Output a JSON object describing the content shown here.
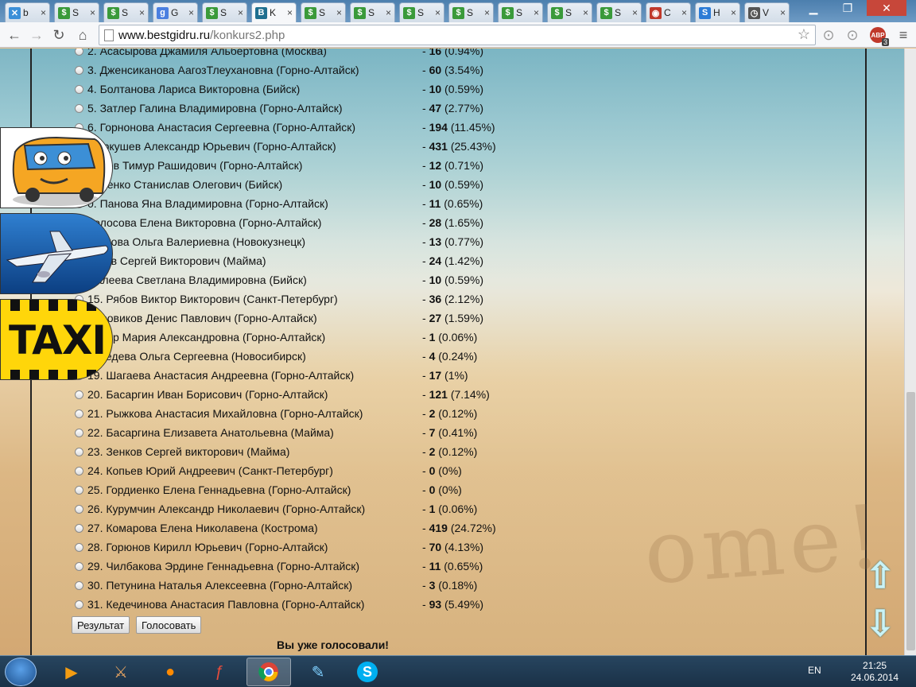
{
  "browser": {
    "tabs": [
      {
        "label": "b",
        "icon": "x-icon",
        "color": "#3b8fd8",
        "glyph": "✕"
      },
      {
        "label": "S",
        "icon": "dollar-icon",
        "color": "#3a9a3a",
        "glyph": "$"
      },
      {
        "label": "S",
        "icon": "dollar-icon",
        "color": "#3a9a3a",
        "glyph": "$"
      },
      {
        "label": "G",
        "icon": "google-icon",
        "color": "#4a7fe0",
        "glyph": "g"
      },
      {
        "label": "S",
        "icon": "dollar-icon",
        "color": "#3a9a3a",
        "glyph": "$"
      },
      {
        "label": "K",
        "icon": "bg-icon",
        "color": "#1f6f8f",
        "glyph": "B"
      },
      {
        "label": "S",
        "icon": "dollar-icon",
        "color": "#3a9a3a",
        "glyph": "$"
      },
      {
        "label": "S",
        "icon": "dollar-icon",
        "color": "#3a9a3a",
        "glyph": "$"
      },
      {
        "label": "S",
        "icon": "dollar-icon",
        "color": "#3a9a3a",
        "glyph": "$"
      },
      {
        "label": "S",
        "icon": "dollar-icon",
        "color": "#3a9a3a",
        "glyph": "$"
      },
      {
        "label": "S",
        "icon": "dollar-icon",
        "color": "#3a9a3a",
        "glyph": "$"
      },
      {
        "label": "S",
        "icon": "dollar-icon",
        "color": "#3a9a3a",
        "glyph": "$"
      },
      {
        "label": "S",
        "icon": "dollar-icon",
        "color": "#3a9a3a",
        "glyph": "$"
      },
      {
        "label": "C",
        "icon": "camera-icon",
        "color": "#c0392b",
        "glyph": "◉"
      },
      {
        "label": "H",
        "icon": "sb-icon",
        "color": "#2c7bd6",
        "glyph": "S"
      },
      {
        "label": "V",
        "icon": "clock-icon",
        "color": "#555555",
        "glyph": "◷"
      }
    ],
    "url_host": "www.bestgidru.ru",
    "url_path": "/konkurs2.php",
    "abp_badge": "3"
  },
  "poll": {
    "rows": [
      {
        "name": "2. Асасырова Джамиля Альбертовна (Москва)",
        "votes": "16",
        "pct": "(0.94%)"
      },
      {
        "name": "3. Дженсиканова АагозТлеухановна (Горно-Алтайск)",
        "votes": "60",
        "pct": "(3.54%)"
      },
      {
        "name": "4. Болтанова Лариса Викторовна (Бийск)",
        "votes": "10",
        "pct": "(0.59%)"
      },
      {
        "name": "5. Затлер Галина Владимировна (Горно-Алтайск)",
        "votes": "47",
        "pct": "(2.77%)"
      },
      {
        "name": "6. Горнонова Анастасия Сергеевна (Горно-Алтайск)",
        "votes": "194",
        "pct": "(11.45%)"
      },
      {
        "name": "Меркушев Александр Юрьевич (Горно-Алтайск)",
        "votes": "431",
        "pct": "(25.43%)"
      },
      {
        "name": "жанов Тимур Рашидович (Горно-Алтайск)",
        "votes": "12",
        "pct": "(0.71%)"
      },
      {
        "name": "емченко Станислав Олегович (Бийск)",
        "votes": "10",
        "pct": "(0.59%)"
      },
      {
        "name": "0. Панова Яна Владимировна (Горно-Алтайск)",
        "votes": "11",
        "pct": "(0.65%)"
      },
      {
        "name": "Колосова Елена Викторовна (Горно-Алтайск)",
        "votes": "28",
        "pct": "(1.65%)"
      },
      {
        "name": "ерикова Ольга Валериевна (Новокузнецк)",
        "votes": "13",
        "pct": "(0.77%)"
      },
      {
        "name": "енков Сергей Викторович (Майма)",
        "votes": "24",
        "pct": "(1.42%)"
      },
      {
        "name": "Фалеева Светлана Владимировна (Бийск)",
        "votes": "10",
        "pct": "(0.59%)"
      },
      {
        "name": "15. Рябов Виктор Викторович (Санкт-Петербург)",
        "votes": "36",
        "pct": "(2.12%)"
      },
      {
        "name": "Боровиков Денис Павлович (Горно-Алтайск)",
        "votes": "27",
        "pct": "(1.59%)"
      },
      {
        "name": "иллер Мария Александровна (Горно-Алтайск)",
        "votes": "1",
        "pct": "(0.06%)"
      },
      {
        "name": "едведева Ольга Сергеевна (Новосибирск)",
        "votes": "4",
        "pct": "(0.24%)"
      },
      {
        "name": "19. Шагаева Анастасия Андреевна (Горно-Алтайск)",
        "votes": "17",
        "pct": "(1%)"
      },
      {
        "name": "20. Басаргин Иван Борисович (Горно-Алтайск)",
        "votes": "121",
        "pct": "(7.14%)"
      },
      {
        "name": "21. Рыжкова Анастасия Михайловна (Горно-Алтайск)",
        "votes": "2",
        "pct": "(0.12%)"
      },
      {
        "name": "22. Басаргина Елизавета Анатольевна (Майма)",
        "votes": "7",
        "pct": "(0.41%)"
      },
      {
        "name": "23. Зенков Сергей викторович (Майма)",
        "votes": "2",
        "pct": "(0.12%)"
      },
      {
        "name": "24. Копьев Юрий Андреевич (Санкт-Петербург)",
        "votes": "0",
        "pct": "(0%)"
      },
      {
        "name": "25. Гордиенко Елена Геннадьевна (Горно-Алтайск)",
        "votes": "0",
        "pct": "(0%)"
      },
      {
        "name": "26. Курумчин Александр Николаевич (Горно-Алтайск)",
        "votes": "1",
        "pct": "(0.06%)"
      },
      {
        "name": "27. Комарова Елена Николавена (Кострома)",
        "votes": "419",
        "pct": "(24.72%)"
      },
      {
        "name": "28. Горюнов Кирилл Юрьевич (Горно-Алтайск)",
        "votes": "70",
        "pct": "(4.13%)"
      },
      {
        "name": "29. Чилбакова Эрдине Геннадьевна (Горно-Алтайск)",
        "votes": "11",
        "pct": "(0.65%)"
      },
      {
        "name": "30. Петунина Наталья Алексеевна (Горно-Алтайск)",
        "votes": "3",
        "pct": "(0.18%)"
      },
      {
        "name": "31. Кедечинова Анастасия Павловна (Горно-Алтайск)",
        "votes": "93",
        "pct": "(5.49%)"
      }
    ],
    "result_button": "Результат",
    "vote_button": "Голосовать",
    "already_voted": "Вы уже голосовали!",
    "sand_text": "ome!",
    "taxi_text": "TAXI"
  },
  "taskbar": {
    "lang": "EN",
    "time": "21:25",
    "date": "24.06.2014"
  }
}
